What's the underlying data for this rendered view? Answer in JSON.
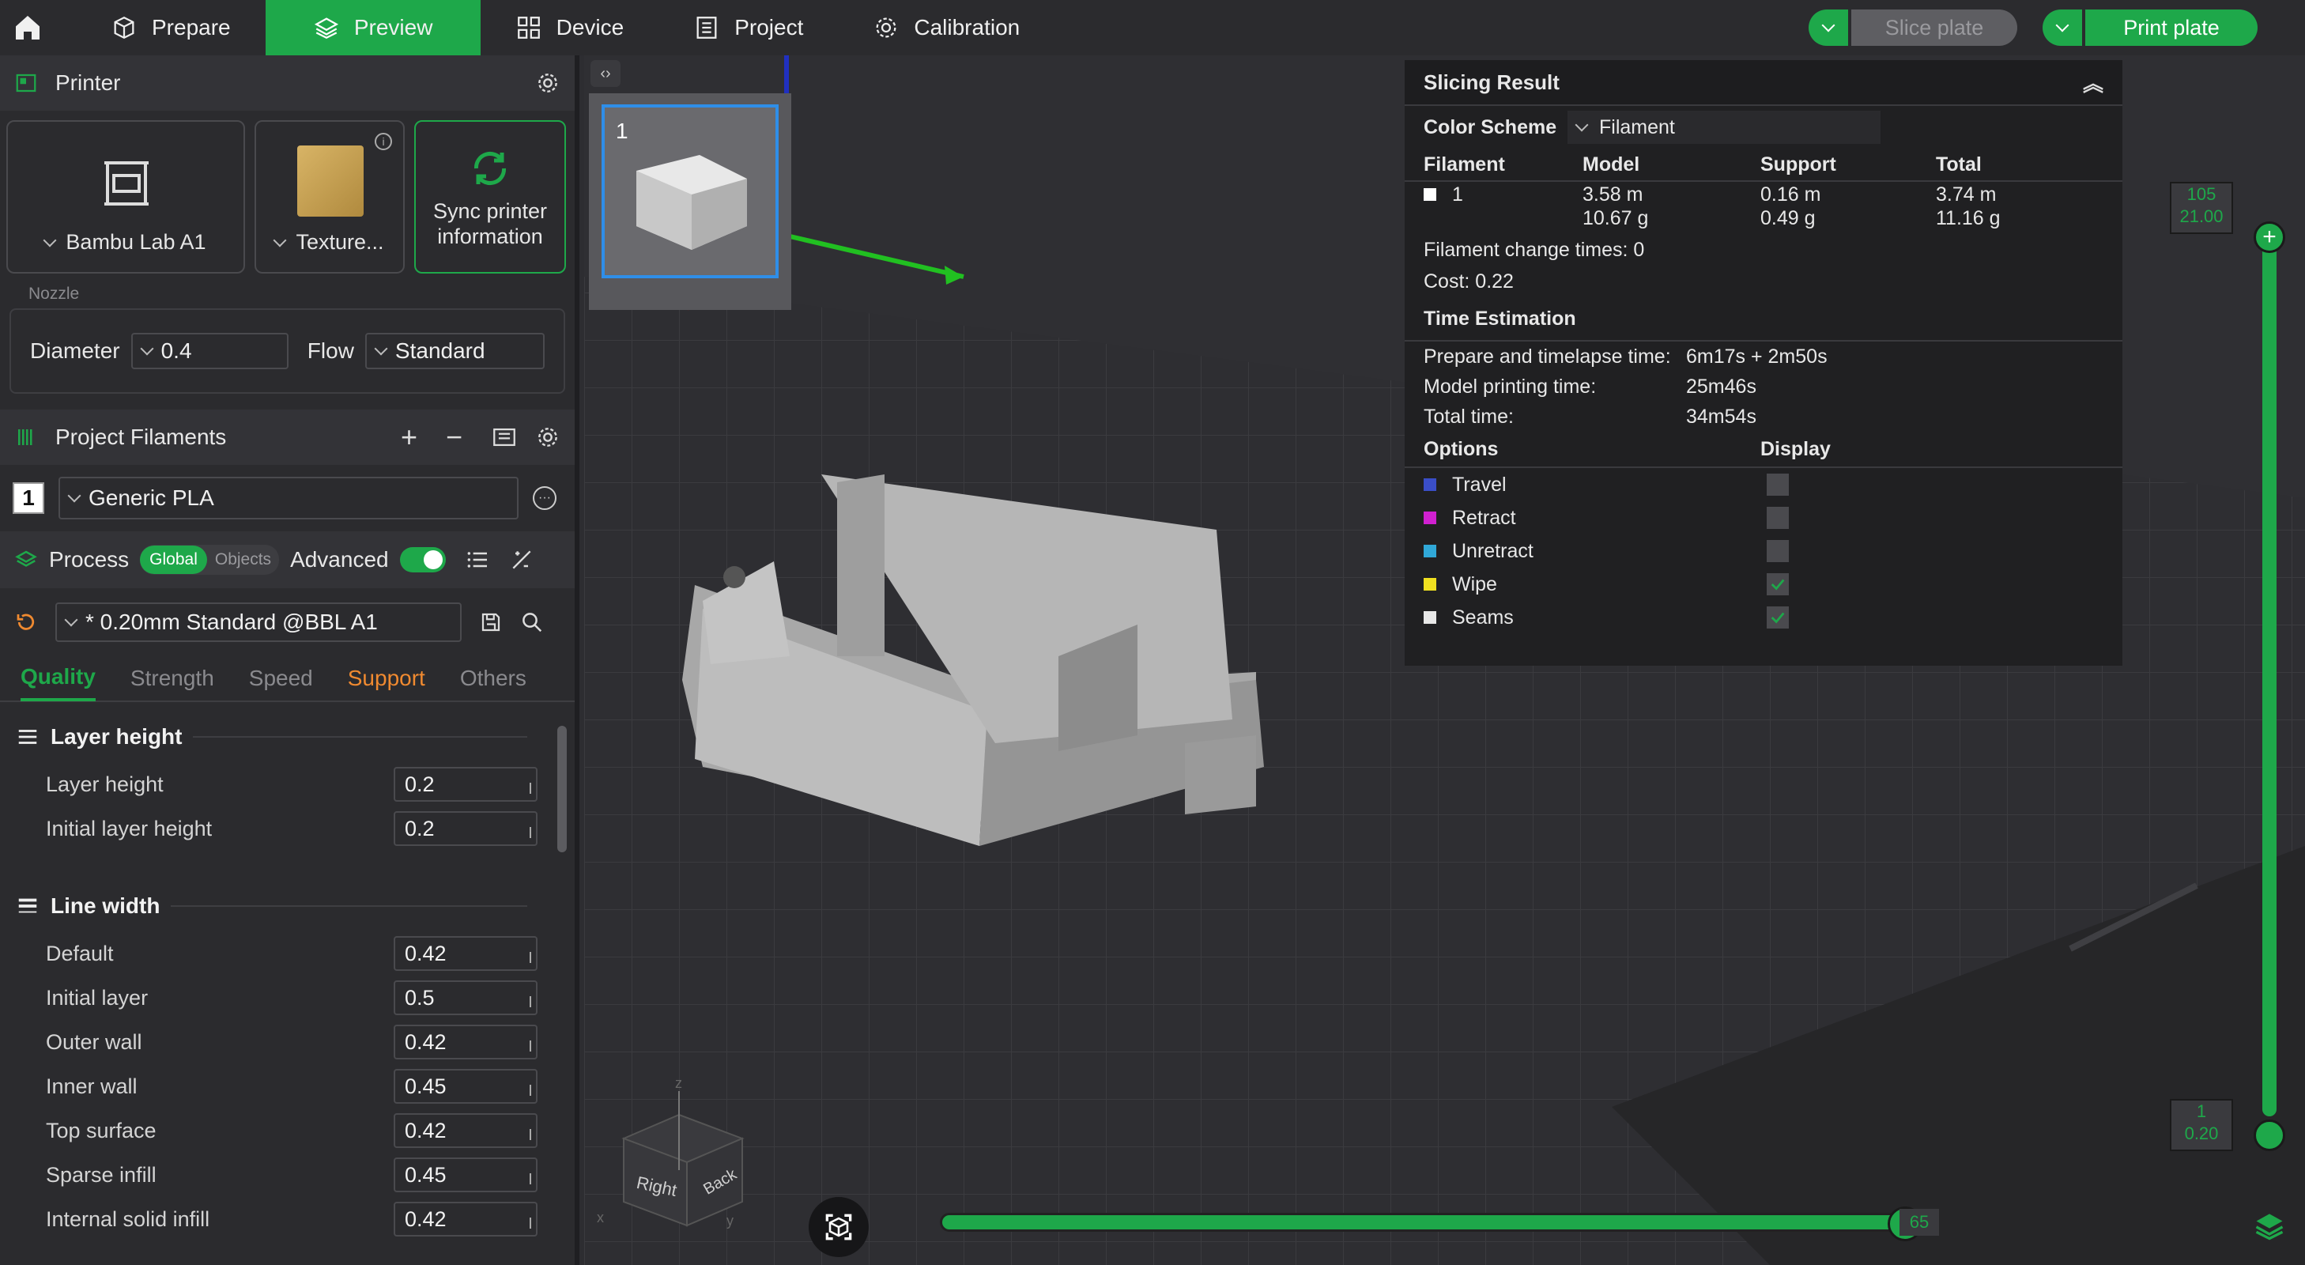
{
  "nav": {
    "tabs": [
      {
        "label": "Prepare"
      },
      {
        "label": "Preview"
      },
      {
        "label": "Device"
      },
      {
        "label": "Project"
      },
      {
        "label": "Calibration"
      }
    ],
    "slice_label": "Slice plate",
    "print_label": "Print plate"
  },
  "printer": {
    "title": "Printer",
    "printer_name": "Bambu Lab A1",
    "plate_name": "Texture...",
    "sync_label_1": "Sync printer",
    "sync_label_2": "information",
    "nozzle_label": "Nozzle",
    "diameter_label": "Diameter",
    "diameter_value": "0.4",
    "flow_label": "Flow",
    "flow_value": "Standard"
  },
  "filaments": {
    "title": "Project Filaments",
    "items": [
      {
        "num": "1",
        "name": "Generic PLA"
      }
    ]
  },
  "process": {
    "title": "Process",
    "seg_global": "Global",
    "seg_objects": "Objects",
    "advanced_label": "Advanced",
    "preset": "* 0.20mm Standard @BBL A1",
    "tabs": [
      "Quality",
      "Strength",
      "Speed",
      "Support",
      "Others"
    ]
  },
  "params": {
    "group1": "Layer height",
    "layer_height_label": "Layer height",
    "layer_height": "0.2",
    "initial_layer_height_label": "Initial layer height",
    "initial_layer_height": "0.2",
    "group2": "Line width",
    "lines": [
      {
        "label": "Default",
        "value": "0.42"
      },
      {
        "label": "Initial layer",
        "value": "0.5"
      },
      {
        "label": "Outer wall",
        "value": "0.42"
      },
      {
        "label": "Inner wall",
        "value": "0.45"
      },
      {
        "label": "Top surface",
        "value": "0.42"
      },
      {
        "label": "Sparse infill",
        "value": "0.45"
      },
      {
        "label": "Internal solid infill",
        "value": "0.42"
      }
    ]
  },
  "viewport": {
    "plate_number": "1",
    "cube_right": "Right",
    "cube_back": "Back"
  },
  "result": {
    "title": "Slicing Result",
    "color_scheme_label": "Color Scheme",
    "color_scheme_value": "Filament",
    "headers": [
      "Filament",
      "Model",
      "Support",
      "Total"
    ],
    "row": {
      "filament": "1",
      "model_len": "3.58 m",
      "model_wt": "10.67 g",
      "support_len": "0.16 m",
      "support_wt": "0.49 g",
      "total_len": "3.74 m",
      "total_wt": "11.16 g"
    },
    "change_times": "Filament change times:  0",
    "cost": "Cost:  0.22",
    "time_title": "Time Estimation",
    "prep_label": "Prepare and timelapse time:",
    "prep_value": "6m17s + 2m50s",
    "model_time_label": "Model printing time:",
    "model_time_value": "25m46s",
    "total_label": "Total time:",
    "total_value": "34m54s",
    "options_label": "Options",
    "display_label": "Display",
    "options": [
      {
        "label": "Travel",
        "color": "#3a4ec8",
        "checked": false
      },
      {
        "label": "Retract",
        "color": "#d020d0",
        "checked": false
      },
      {
        "label": "Unretract",
        "color": "#30a8d8",
        "checked": false
      },
      {
        "label": "Wipe",
        "color": "#f0e020",
        "checked": true
      },
      {
        "label": "Seams",
        "color": "#e8e8e8",
        "checked": true
      }
    ]
  },
  "sliders": {
    "top_layer": "105",
    "top_height": "21.00",
    "bottom_layer": "1",
    "bottom_height": "0.20",
    "move_value": "65",
    "move_fraction": 0.985
  },
  "colors": {
    "accent": "#1ea84a",
    "bg": "#2b2b2e"
  }
}
